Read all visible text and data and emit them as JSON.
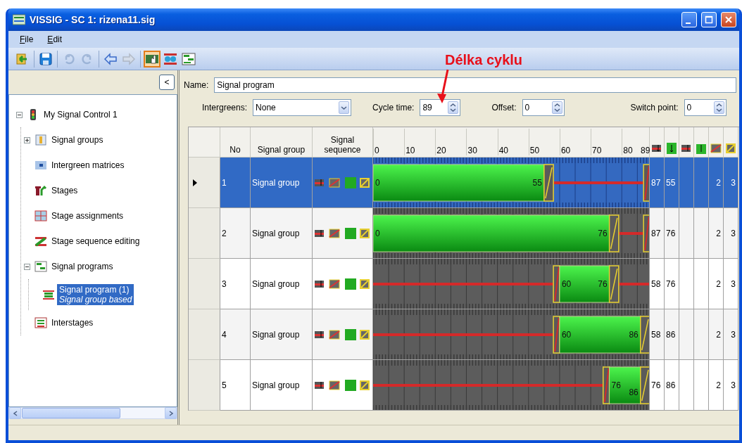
{
  "window": {
    "title": "VISSIG - SC 1: rizena11.sig"
  },
  "menu": [
    "File",
    "Edit"
  ],
  "toolbar": [
    [
      {
        "kind": "exit",
        "disabled": false,
        "selected": false
      }
    ],
    [
      {
        "kind": "save",
        "disabled": false,
        "selected": false
      }
    ],
    [
      {
        "kind": "undo",
        "disabled": true,
        "selected": false
      },
      {
        "kind": "redo",
        "disabled": true,
        "selected": false
      }
    ],
    [
      {
        "kind": "back",
        "disabled": false,
        "selected": false
      },
      {
        "kind": "forward",
        "disabled": true,
        "selected": false
      }
    ],
    [
      {
        "kind": "hand",
        "disabled": false,
        "selected": true
      },
      {
        "kind": "sequence",
        "disabled": false,
        "selected": false
      },
      {
        "kind": "program",
        "disabled": false,
        "selected": false
      }
    ]
  ],
  "annotation": {
    "text": "Délka cyklu"
  },
  "sidebar": {
    "collapse_button": "<",
    "tree": [
      {
        "label": "My Signal Control 1",
        "kind": "controller",
        "expanded": true,
        "selected": false,
        "children": [
          {
            "label": "Signal groups",
            "kind": "signal-groups",
            "expanded": false,
            "selected": false
          },
          {
            "label": "Intergreen matrices",
            "kind": "matrix",
            "selected": false
          },
          {
            "label": "Stages",
            "kind": "stages",
            "selected": false
          },
          {
            "label": "Stage assignments",
            "kind": "assignments",
            "selected": false
          },
          {
            "label": "Stage sequence editing",
            "kind": "sequence",
            "selected": false
          },
          {
            "label": "Signal programs",
            "kind": "programs",
            "expanded": true,
            "selected": false,
            "children": [
              {
                "label": "Signal program (1)",
                "sublabel": "Signal group based",
                "kind": "program",
                "selected": true
              }
            ]
          },
          {
            "label": "Interstages",
            "kind": "interstages",
            "selected": false
          }
        ]
      }
    ]
  },
  "form": {
    "name": {
      "label": "Name:",
      "value": "Signal program"
    },
    "intergreens": {
      "label": "Intergreens:",
      "value": "None"
    },
    "cycle_time": {
      "label": "Cycle time:",
      "value": "89"
    },
    "offset": {
      "label": "Offset:",
      "value": "0"
    },
    "switch_point": {
      "label": "Switch point:",
      "value": "0"
    }
  },
  "table": {
    "columns": [
      {
        "kind": "text",
        "label": "No"
      },
      {
        "kind": "text",
        "label": "Signal group"
      },
      {
        "kind": "text",
        "label": "Signal sequence"
      },
      {
        "kind": "timeline"
      },
      {
        "kind": "red-end"
      },
      {
        "kind": "green-end"
      },
      {
        "kind": "red-start"
      },
      {
        "kind": "green-start"
      },
      {
        "kind": "red-amber"
      },
      {
        "kind": "amber"
      }
    ],
    "ticks": [
      "0",
      "10",
      "20",
      "30",
      "40",
      "50",
      "60",
      "70",
      "80",
      "89"
    ],
    "rows": [
      {
        "no": "1",
        "signal_group": "Signal group",
        "selected": true,
        "green_start": "0",
        "green_end": "55",
        "end_values": [
          "87",
          "55"
        ],
        "counts": [
          "2",
          "3"
        ]
      },
      {
        "no": "2",
        "signal_group": "Signal group",
        "selected": false,
        "green_start": "0",
        "green_end": "76",
        "end_values": [
          "87",
          "76"
        ],
        "counts": [
          "2",
          "3"
        ]
      },
      {
        "no": "3",
        "signal_group": "Signal group",
        "selected": false,
        "green_start": "60",
        "green_end": "76",
        "end_values": [
          "58",
          "76"
        ],
        "counts": [
          "2",
          "3"
        ]
      },
      {
        "no": "4",
        "signal_group": "Signal group",
        "selected": false,
        "green_start": "60",
        "green_end": "86",
        "end_values": [
          "58",
          "86"
        ],
        "counts": [
          "2",
          "3"
        ]
      },
      {
        "no": "5",
        "signal_group": "Signal group",
        "selected": false,
        "green_start": "76",
        "green_end": "86",
        "end_values": [
          "76",
          "86"
        ],
        "counts": [
          "2",
          "3"
        ]
      }
    ]
  }
}
